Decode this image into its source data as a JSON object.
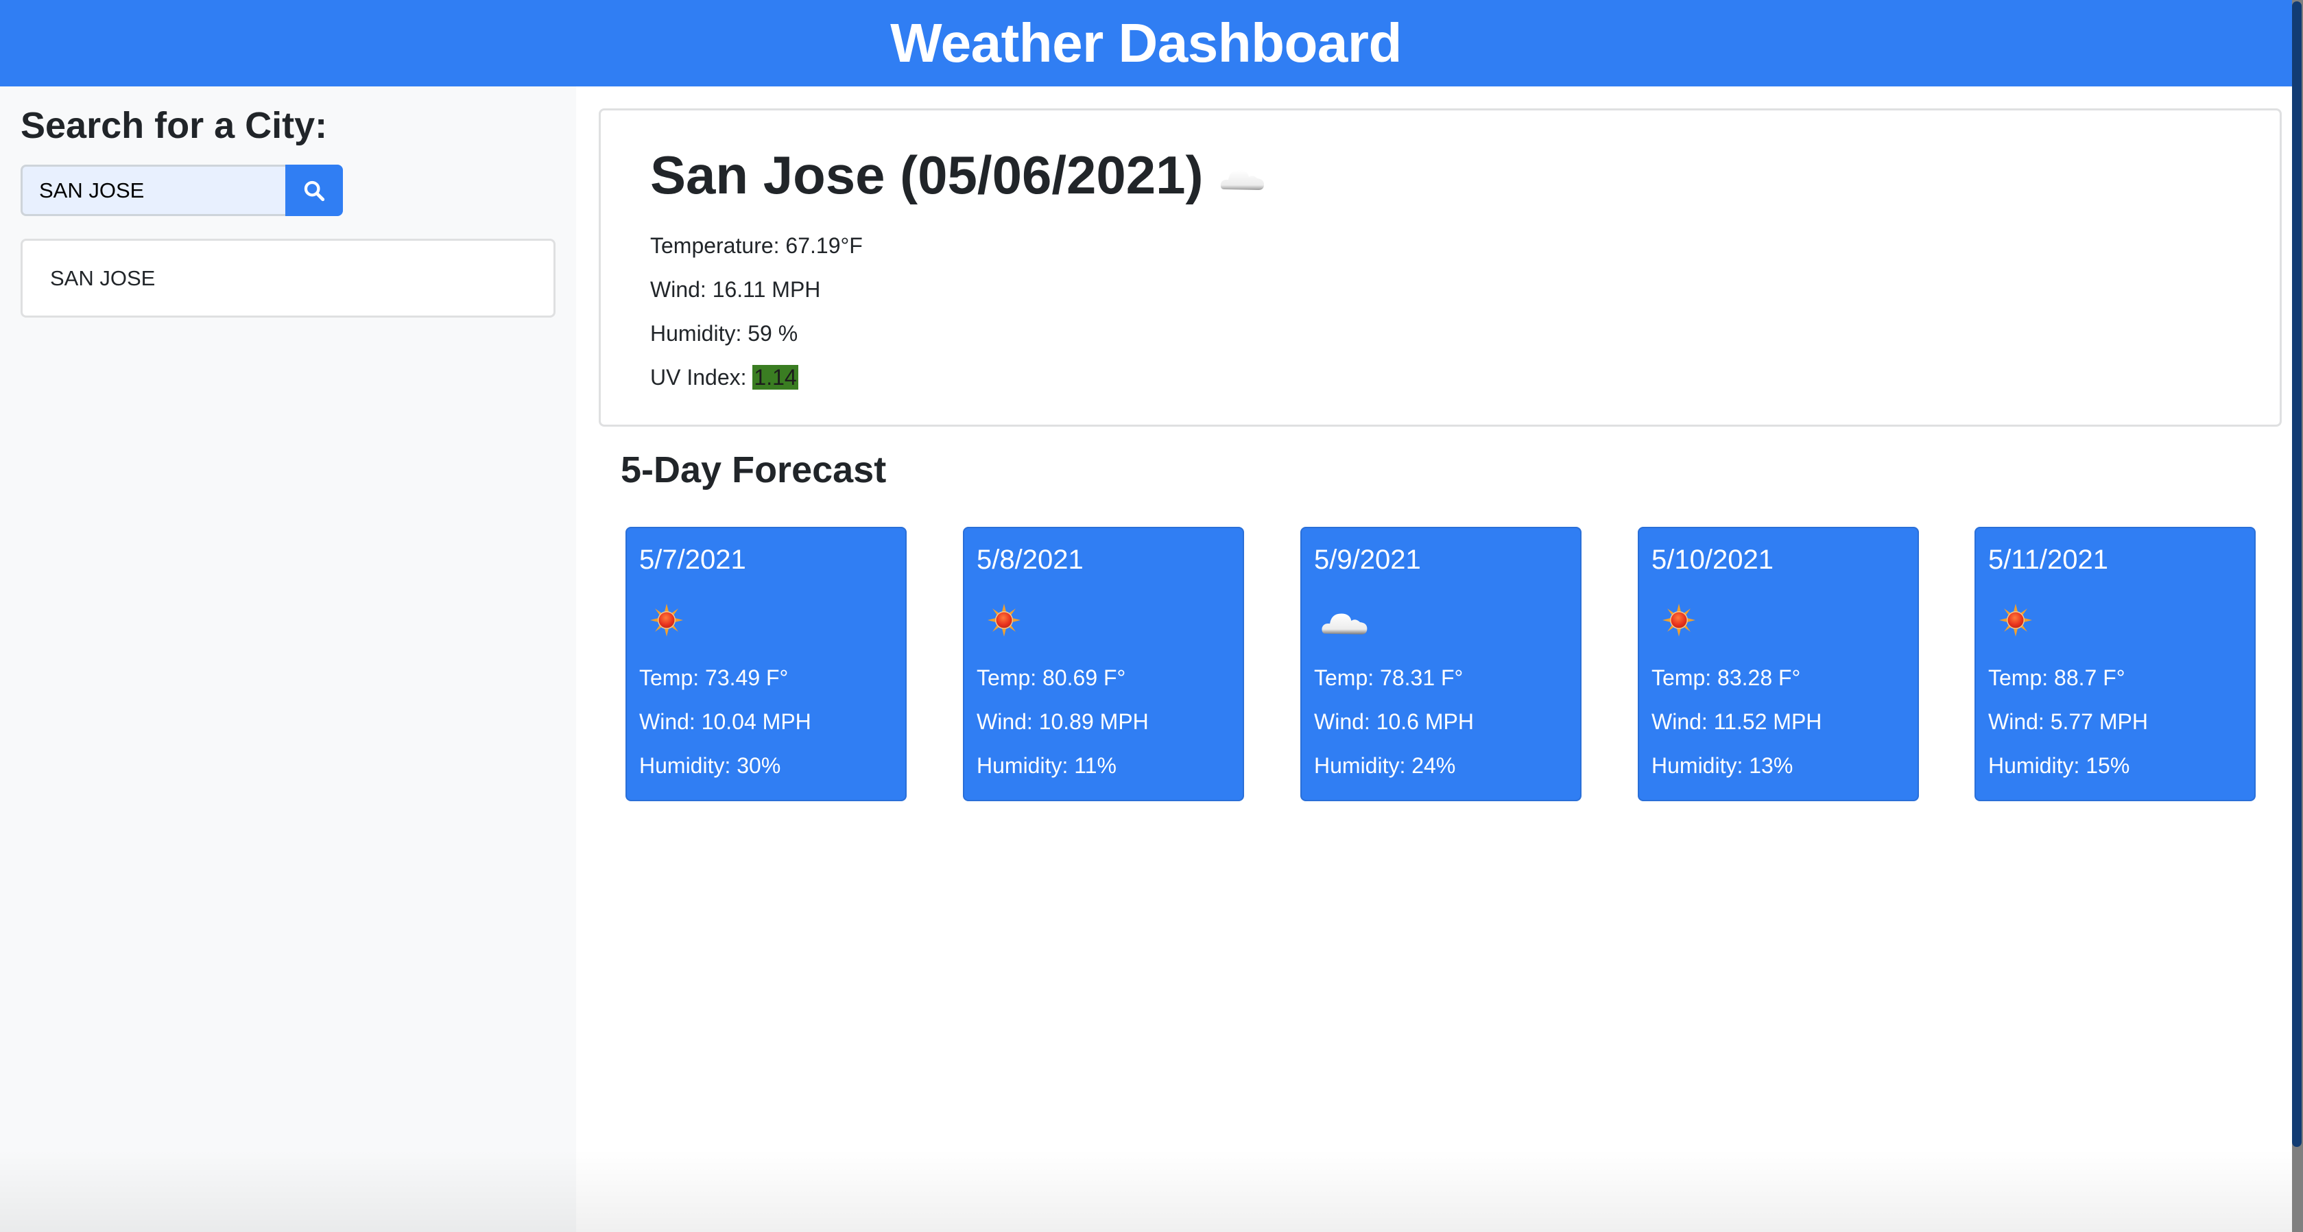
{
  "header": {
    "title": "Weather Dashboard"
  },
  "sidebar": {
    "heading": "Search for a City:",
    "search": {
      "value": "SAN JOSE",
      "placeholder": "",
      "button_icon": "search-icon"
    },
    "history": [
      {
        "label": "SAN JOSE"
      }
    ]
  },
  "current": {
    "title": "San Jose (05/06/2021)",
    "icon": "cloud-icon",
    "temperature_label": "Temperature: ",
    "temperature": "67.19°F",
    "wind_label": "Wind: ",
    "wind": "16.11 MPH",
    "humidity_label": "Humidity: ",
    "humidity": "59 %",
    "uv_label": "UV Index: ",
    "uv": "1.14",
    "uv_color": "#3a7d22"
  },
  "forecast": {
    "heading": "5-Day Forecast",
    "days": [
      {
        "date": "5/7/2021",
        "icon": "sun-icon",
        "temp": "Temp: 73.49 F°",
        "wind": "Wind: 10.04 MPH",
        "humidity": "Humidity: 30%"
      },
      {
        "date": "5/8/2021",
        "icon": "sun-icon",
        "temp": "Temp: 80.69 F°",
        "wind": "Wind: 10.89 MPH",
        "humidity": "Humidity: 11%"
      },
      {
        "date": "5/9/2021",
        "icon": "cloud-icon",
        "temp": "Temp: 78.31 F°",
        "wind": "Wind: 10.6 MPH",
        "humidity": "Humidity: 24%"
      },
      {
        "date": "5/10/2021",
        "icon": "sun-icon",
        "temp": "Temp: 83.28 F°",
        "wind": "Wind: 11.52 MPH",
        "humidity": "Humidity: 13%"
      },
      {
        "date": "5/11/2021",
        "icon": "sun-icon",
        "temp": "Temp: 88.7 F°",
        "wind": "Wind: 5.77 MPH",
        "humidity": "Humidity: 15%"
      }
    ]
  },
  "colors": {
    "primary": "#307ef3",
    "sidebar_bg": "#f8f9fa",
    "text": "#212529"
  }
}
